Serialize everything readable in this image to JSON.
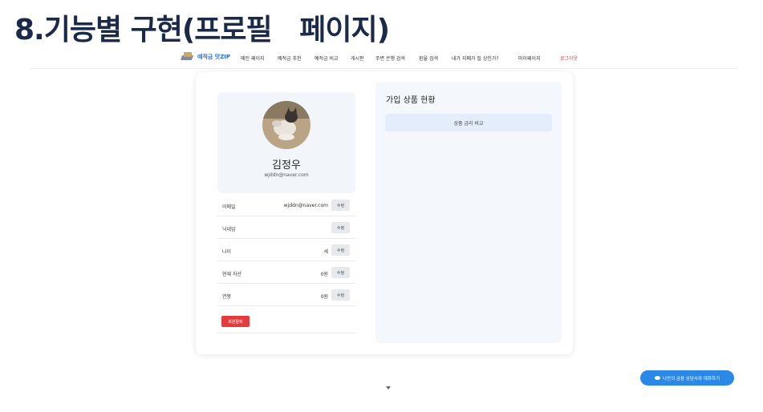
{
  "slide_title": "8.기능별 구현(프로필   페이지)",
  "nav": {
    "brand": "예적금 맛ZIP",
    "items": [
      "메인 페이지",
      "예적금 추천",
      "예적금 비교",
      "게시판",
      "주변 은행 검색",
      "환율 검색",
      "내가 지폐가 될 상인가?",
      "마이페이지"
    ],
    "logout": "로그아웃"
  },
  "profile": {
    "name": "김정우",
    "email": "wjddn@naver.com"
  },
  "info_rows": [
    {
      "label": "이메일",
      "value": "wjddn@naver.com",
      "button": "수정"
    },
    {
      "label": "닉네임",
      "value": "",
      "button": "수정"
    },
    {
      "label": "나이",
      "value": "세",
      "button": "수정"
    },
    {
      "label": "현재 자산",
      "value": "0원",
      "button": "수정"
    },
    {
      "label": "연봉",
      "value": "0원",
      "button": "수정"
    }
  ],
  "withdraw_label": "회원탈퇴",
  "products": {
    "title": "가입 상품 현황",
    "compare_button": "상품 금리 비교"
  },
  "chat_button": "나만의 금융 상담사와 대화하기",
  "colors": {
    "brand": "#2a6fd6",
    "logout": "#e03c3c",
    "withdraw": "#e23c3c",
    "chat": "#2b88e6"
  }
}
